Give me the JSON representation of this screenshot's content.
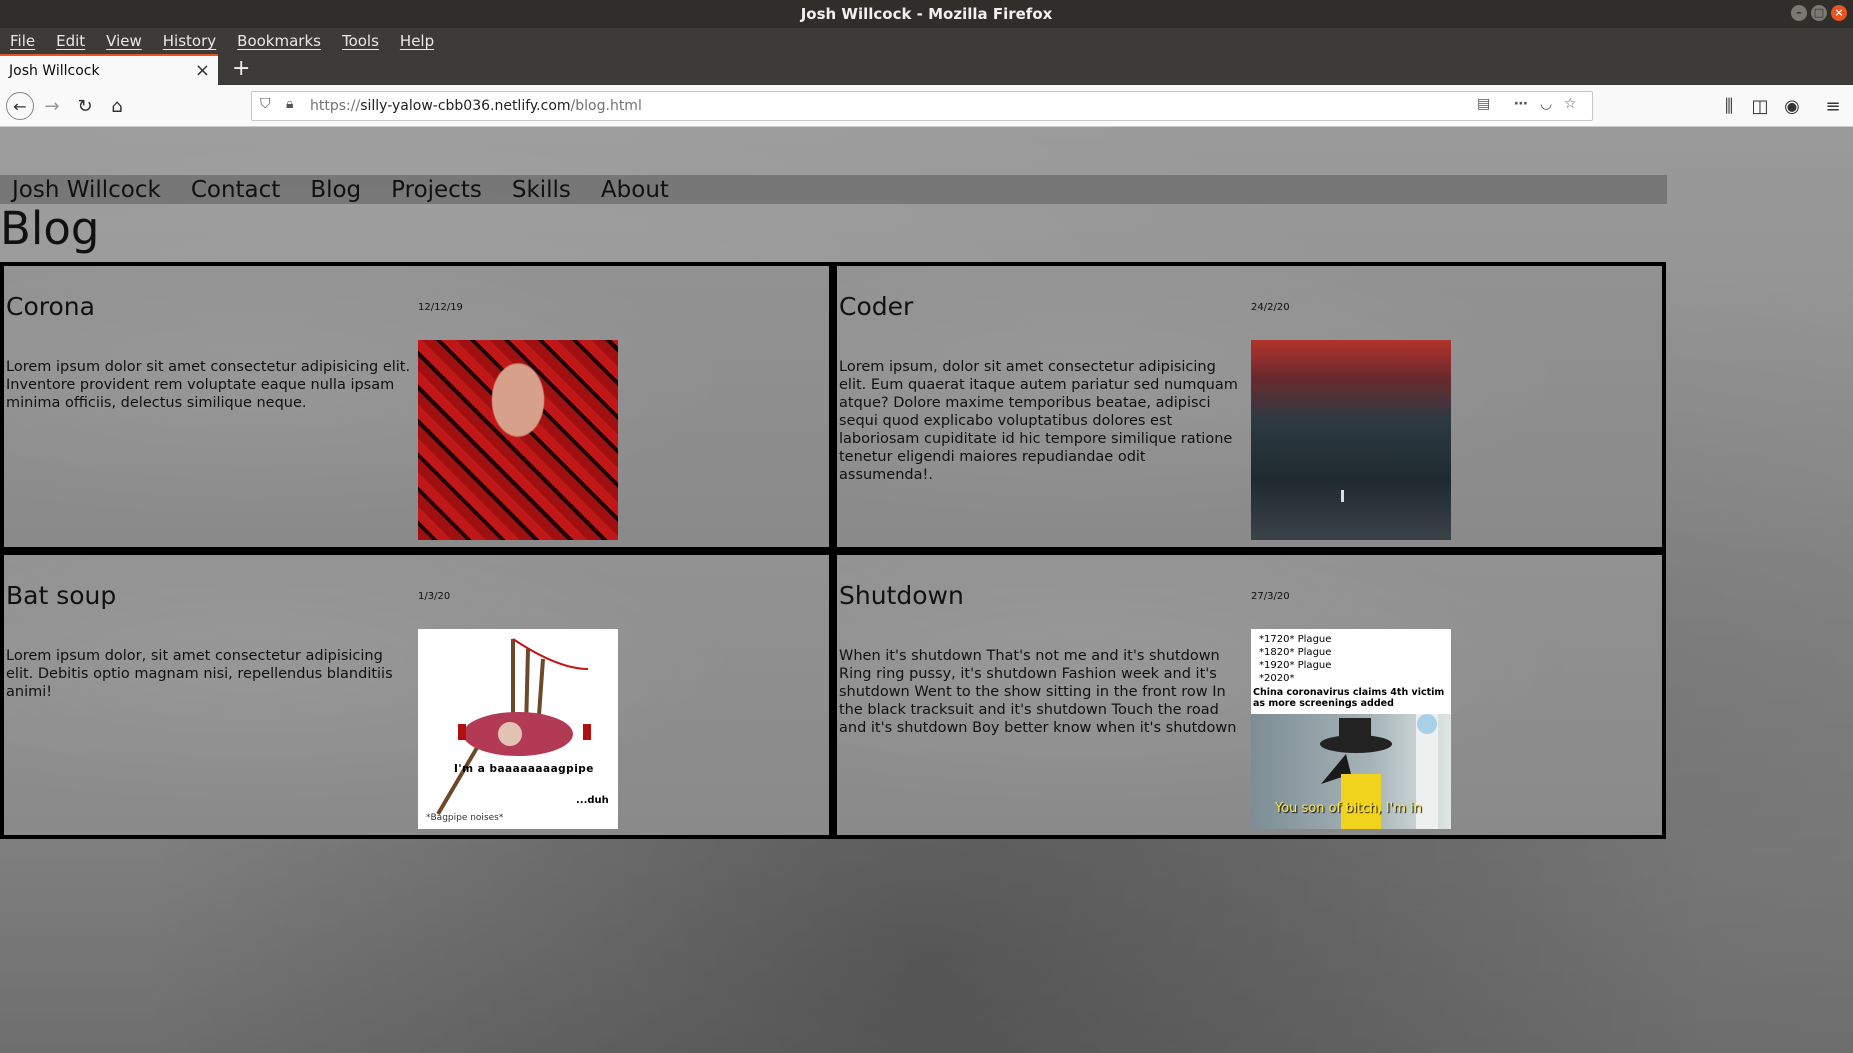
{
  "window": {
    "title": "Josh Willcock - Mozilla Firefox"
  },
  "menubar": {
    "items": [
      "File",
      "Edit",
      "View",
      "History",
      "Bookmarks",
      "Tools",
      "Help"
    ]
  },
  "tabs": [
    {
      "label": "Josh Willcock",
      "close": "×"
    }
  ],
  "newtab": "+",
  "url": {
    "scheme": "https://",
    "host": "silly-yalow-cbb036.netlify.com",
    "path": "/blog.html"
  },
  "site": {
    "nav": [
      "Josh Willcock",
      "Contact",
      "Blog",
      "Projects",
      "Skills",
      "About"
    ],
    "page_title": "Blog",
    "posts": [
      {
        "title": "Corona",
        "date": "12/12/19",
        "text": "Lorem ipsum dolor sit amet consectetur adipisicing elit. Inventore provident rem voluptate eaque nulla ipsam minima officiis, delectus similique neque."
      },
      {
        "title": "Coder",
        "date": "24/2/20",
        "text": "Lorem ipsum, dolor sit amet consectetur adipisicing elit. Eum quaerat itaque autem pariatur sed numquam atque? Dolore maxime temporibus beatae, adipisci sequi quod explicabo voluptatibus dolores est laboriosam cupiditate id hic tempore similique ratione tenetur eligendi maiores repudiandae odit assumenda!."
      },
      {
        "title": "Bat soup",
        "date": "1/3/20",
        "text": "Lorem ipsum dolor, sit amet consectetur adipisicing elit. Debitis optio magnam nisi, repellendus blanditiis animi!",
        "image_text": {
          "caption": "I'm a baaaaaaaagpipe",
          "duh": "...duh",
          "noise": "*Bagpipe noises*"
        }
      },
      {
        "title": "Shutdown",
        "date": "27/3/20",
        "text": "When it's shutdown That's not me and it's shutdown Ring ring pussy, it's shutdown Fashion week and it's shutdown Went to the show sitting in the front row In the black tracksuit and it's shutdown Touch the road and it's shutdown Boy better know when it's shutdown",
        "image_text": {
          "l1": "*1720* Plague",
          "l2": "*1820* Plague",
          "l3": "*1920* Plague",
          "l4": "*2020*",
          "headline": "China coronavirus claims 4th victim as more screenings added",
          "caption": "You son of bitch, I'm in"
        }
      }
    ]
  },
  "colors": {
    "accent": "#e95420",
    "chrome_dark": "#3c3b37",
    "card_border": "#000000"
  }
}
